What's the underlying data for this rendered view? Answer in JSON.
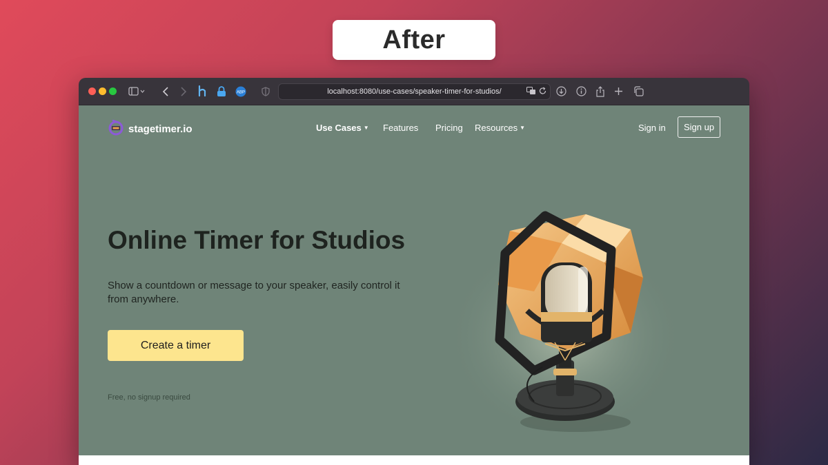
{
  "badge": {
    "label": "After"
  },
  "browser": {
    "url": "localhost:8080/use-cases/speaker-timer-for-studios/",
    "traffic_lights": [
      "#fe5f57",
      "#febc2e",
      "#28c840"
    ]
  },
  "site": {
    "logo_text": "stagetimer.io",
    "nav": {
      "use_cases": "Use Cases",
      "features": "Features",
      "pricing": "Pricing",
      "resources": "Resources"
    },
    "sign_in": "Sign in",
    "sign_up": "Sign up"
  },
  "hero": {
    "title": "Online Timer for Studios",
    "subtitle": "Show a countdown or message to your speaker, easily control it from anywhere.",
    "cta": "Create a timer",
    "note": "Free, no signup required"
  },
  "colors": {
    "page_bg": "#6f8478",
    "cta_bg": "#fde58e",
    "accent_orange": "#e8a04a"
  }
}
